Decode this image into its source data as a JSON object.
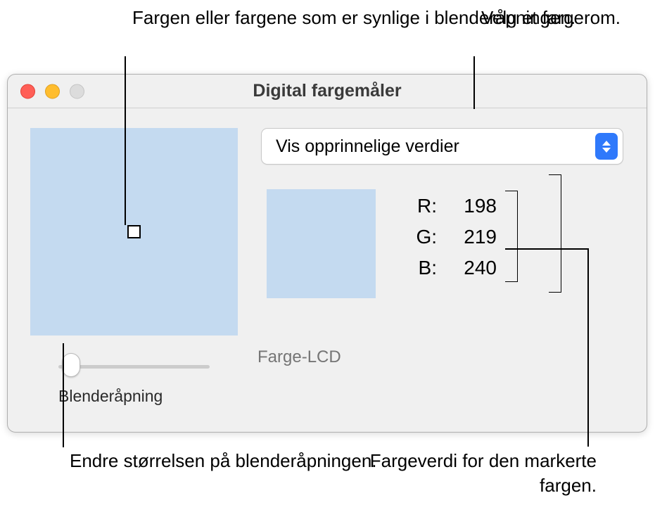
{
  "callouts": {
    "aperture_colors": "Fargen eller fargene som er synlige i blenderåpningen.",
    "color_space": "Velg et fargerom.",
    "aperture_size": "Endre størrelsen på blenderåpningen.",
    "color_value": "Fargeverdi for den markerte fargen."
  },
  "window": {
    "title": "Digital fargemåler"
  },
  "dropdown": {
    "selected": "Vis opprinnelige verdier"
  },
  "rgb": {
    "r_label": "R:",
    "r_value": "198",
    "g_label": "G:",
    "g_value": "219",
    "b_label": "B:",
    "b_value": "240"
  },
  "display": {
    "label": "Farge-LCD"
  },
  "slider": {
    "label": "Blenderåpning"
  },
  "colors": {
    "sampled": "#c6dbf0"
  }
}
